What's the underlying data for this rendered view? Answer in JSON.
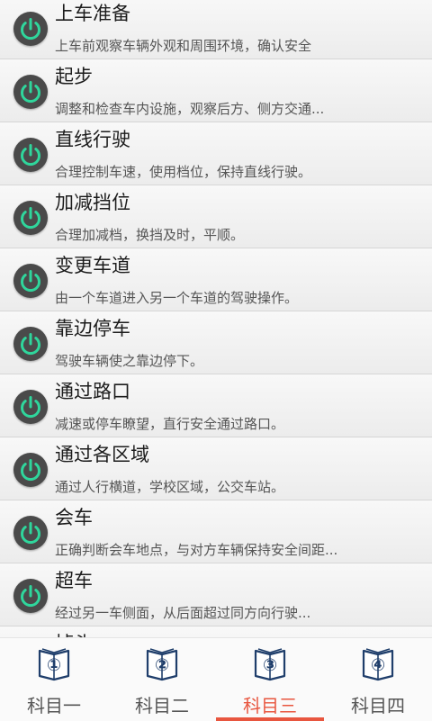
{
  "colors": {
    "accent": "#e8563f",
    "power_ring": "#2fd69c",
    "power_bg": "#4a4a4a",
    "book_blue": "#1f3e6b"
  },
  "items": [
    {
      "title": "上车准备",
      "desc": "上车前观察车辆外观和周围环境，确认安全"
    },
    {
      "title": "起步",
      "desc": "调整和检查车内设施，观察后方、侧方交通..."
    },
    {
      "title": "直线行驶",
      "desc": "合理控制车速，使用档位，保持直线行驶。"
    },
    {
      "title": "加减挡位",
      "desc": "合理加减档，换挡及时，平顺。"
    },
    {
      "title": "变更车道",
      "desc": "由一个车道进入另一个车道的驾驶操作。"
    },
    {
      "title": "靠边停车",
      "desc": "驾驶车辆使之靠边停下。"
    },
    {
      "title": "通过路口",
      "desc": "减速或停车瞭望，直行安全通过路口。"
    },
    {
      "title": "通过各区域",
      "desc": "通过人行横道，学校区域，公交车站。"
    },
    {
      "title": "会车",
      "desc": "正确判断会车地点，与对方车辆保持安全间距..."
    },
    {
      "title": "超车",
      "desc": "经过另一车侧面，从后面超过同方向行驶..."
    },
    {
      "title": "掉头",
      "desc": ""
    }
  ],
  "tabs": [
    {
      "num": "①",
      "label": "科目一"
    },
    {
      "num": "②",
      "label": "科目二"
    },
    {
      "num": "③",
      "label": "科目三"
    },
    {
      "num": "④",
      "label": "科目四"
    }
  ],
  "active_tab": 2
}
